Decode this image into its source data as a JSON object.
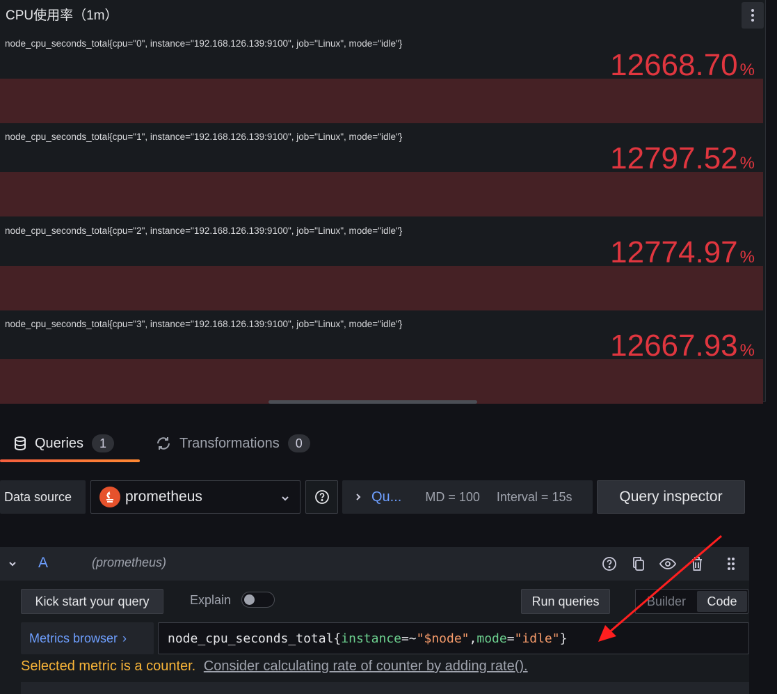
{
  "panel": {
    "title": "CPU使用率（1m）",
    "menu_icon": "kebab-menu-icon",
    "series": [
      {
        "label": "node_cpu_seconds_total{cpu=\"0\", instance=\"192.168.126.139:9100\", job=\"Linux\", mode=\"idle\"}",
        "value": "12668.70",
        "unit": "%"
      },
      {
        "label": "node_cpu_seconds_total{cpu=\"1\", instance=\"192.168.126.139:9100\", job=\"Linux\", mode=\"idle\"}",
        "value": "12797.52",
        "unit": "%"
      },
      {
        "label": "node_cpu_seconds_total{cpu=\"2\", instance=\"192.168.126.139:9100\", job=\"Linux\", mode=\"idle\"}",
        "value": "12774.97",
        "unit": "%"
      },
      {
        "label": "node_cpu_seconds_total{cpu=\"3\", instance=\"192.168.126.139:9100\", job=\"Linux\", mode=\"idle\"}",
        "value": "12667.93",
        "unit": "%"
      }
    ],
    "value_color": "#e0363f",
    "bar_color": "#452125"
  },
  "tabs": {
    "queries": {
      "label": "Queries",
      "count": "1",
      "icon": "database-icon"
    },
    "transformations": {
      "label": "Transformations",
      "count": "0",
      "icon": "transform-icon"
    }
  },
  "datasource": {
    "label": "Data source",
    "selected": "prometheus",
    "logo_icon": "prometheus-logo-icon",
    "options_abbrev": "Qu...",
    "max_data_points": "MD = 100",
    "interval": "Interval = 15s",
    "inspector_label": "Query inspector"
  },
  "query": {
    "ref": "A",
    "datasource_hint": "(prometheus)",
    "kick_start_label": "Kick start your query",
    "explain_label": "Explain",
    "explain_enabled": false,
    "run_label": "Run queries",
    "mode_builder": "Builder",
    "mode_code": "Code",
    "metrics_browser_label": "Metrics browser",
    "metrics_browser_arrow": "›",
    "expr": {
      "metric": "node_cpu_seconds_total",
      "open": "{",
      "label1": "instance",
      "op1": "=~",
      "val1": "\"$node\"",
      "sep": ",",
      "label2": "mode",
      "op2": "=",
      "val2": "\"idle\"",
      "close": "}"
    },
    "warning_text": "Selected metric is a counter.",
    "warning_link": "Consider calculating rate of counter by adding rate().",
    "accent_color": "#6e9fff",
    "warning_color": "#f8b438"
  }
}
